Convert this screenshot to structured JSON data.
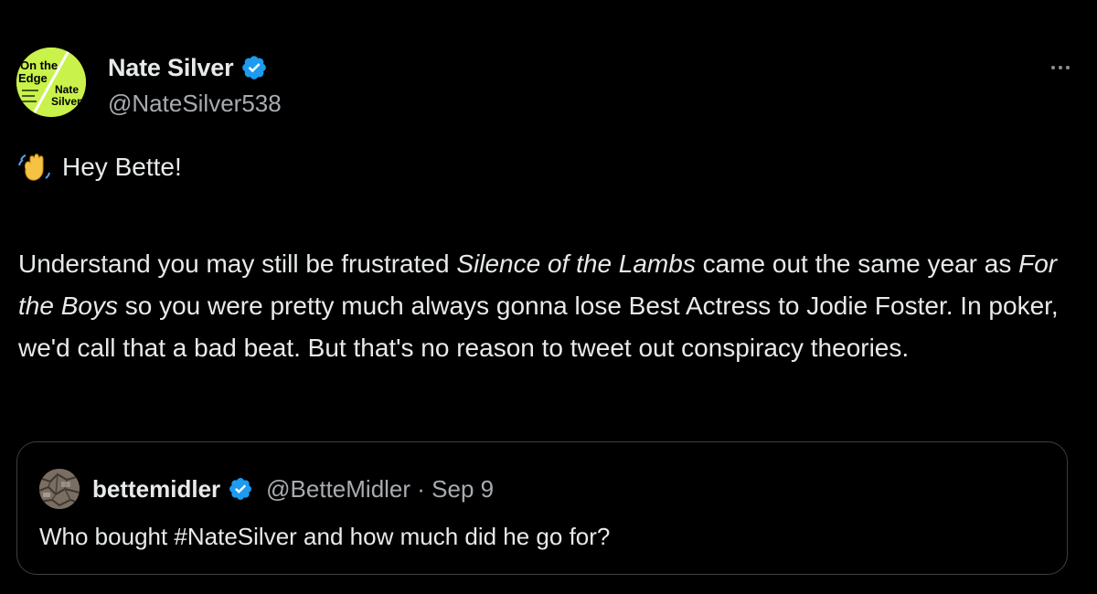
{
  "author": {
    "display_name": "Nate Silver",
    "handle": "@NateSilver538",
    "avatar_text": [
      "On the",
      "Edge",
      "Nate",
      "Silver"
    ],
    "verified": true
  },
  "tweet": {
    "greeting_emoji": "wave-icon",
    "greeting": "Hey Bette!",
    "body_parts": {
      "p1": "Understand you may still be frustrated ",
      "italic1": "Silence of the Lambs",
      "p2": " came out the same year as ",
      "italic2": "For the Boys",
      "p3": " so you were pretty much always gonna lose Best Actress to Jodie Foster. In poker, we'd call that a bad beat. But that's no reason to tweet out conspiracy theories."
    }
  },
  "quoted": {
    "display_name": "bettemidler",
    "meta": "@BetteMidler · Sep 9",
    "text": "Who bought #NateSilver and how much did he go for?",
    "verified": true
  },
  "colors": {
    "background": "#000000",
    "text": "#e7e9ea",
    "secondary": "#a7acb1",
    "verified_blue": "#1d9bf0",
    "avatar_green": "#c9f24a",
    "border": "#3a3f44"
  }
}
